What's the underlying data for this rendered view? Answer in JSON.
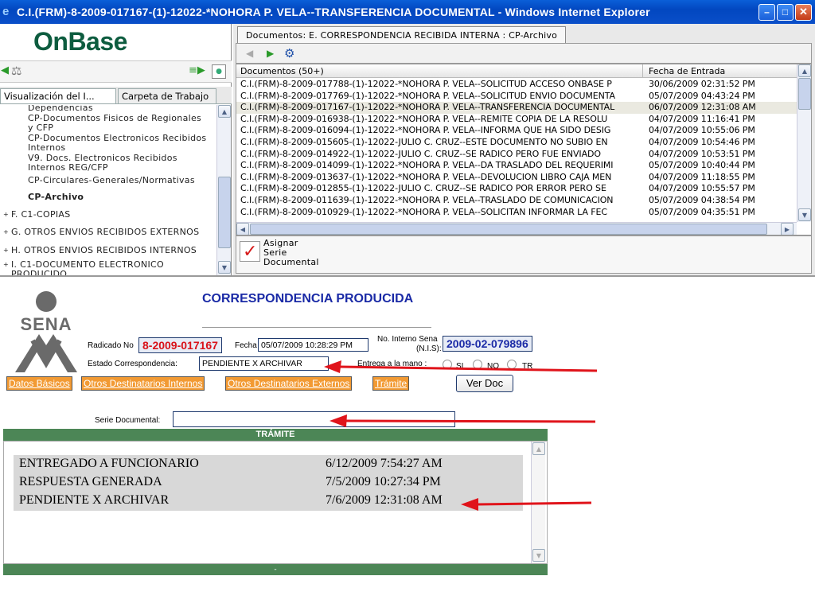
{
  "window": {
    "title": "C.I.(FRM)-8-2009-017167-(1)-12022-*NOHORA P. VELA--TRANSFERENCIA DOCUMENTAL - Windows Internet Explorer"
  },
  "left_panel": {
    "logo": "OnBase",
    "tabs": [
      "Visualización del I...",
      "Carpeta de Trabajo"
    ],
    "tree": [
      "Dependencias",
      "CP-Documentos Fisicos de Regionales",
      "y CFP",
      "CP-Documentos Electronicos Recibidos",
      "Internos",
      "V9. Docs. Electronicos Recibidos",
      "Internos REG/CFP",
      "CP-Circulares-Generales/Normativas",
      "CP-Archivo",
      "F. C1-COPIAS",
      "G. OTROS ENVIOS RECIBIDOS EXTERNOS",
      "H. OTROS ENVIOS RECIBIDOS INTERNOS",
      "I. C1-DOCUMENTO ELECTRONICO",
      "PRODUCIDO"
    ]
  },
  "right_panel": {
    "tab_label": "Documentos: E. CORRESPONDENCIA RECIBIDA INTERNA : CP-Archivo",
    "columns": [
      "Documentos (50+)",
      "Fecha de Entrada"
    ],
    "rows": [
      {
        "doc": "C.I.(FRM)-8-2009-017788-(1)-12022-*NOHORA P. VELA--SOLICITUD ACCESO ONBASE P",
        "date": "30/06/2009 02:31:52 PM"
      },
      {
        "doc": "C.I.(FRM)-8-2009-017769-(1)-12022-*NOHORA P. VELA--SOLICITUD ENVIO DOCUMENTA",
        "date": "05/07/2009 04:43:24 PM"
      },
      {
        "doc": "C.I.(FRM)-8-2009-017167-(1)-12022-*NOHORA P. VELA--TRANSFERENCIA DOCUMENTAL",
        "date": "06/07/2009 12:31:08 AM"
      },
      {
        "doc": "C.I.(FRM)-8-2009-016938-(1)-12022-*NOHORA P. VELA--REMITE COPIA DE LA RESOLU",
        "date": "04/07/2009 11:16:41 PM"
      },
      {
        "doc": "C.I.(FRM)-8-2009-016094-(1)-12022-*NOHORA P. VELA--INFORMA QUE HA SIDO DESIG",
        "date": "04/07/2009 10:55:06 PM"
      },
      {
        "doc": "C.I.(FRM)-8-2009-015605-(1)-12022-JULIO C. CRUZ--ESTE DOCUMENTO NO SUBIO EN",
        "date": "04/07/2009 10:54:46 PM"
      },
      {
        "doc": "C.I.(FRM)-8-2009-014922-(1)-12022-JULIO C. CRUZ--SE RADICO PERO FUE ENVIADO",
        "date": "04/07/2009 10:53:51 PM"
      },
      {
        "doc": "C.I.(FRM)-8-2009-014099-(1)-12022-*NOHORA P. VELA--DA TRASLADO DEL REQUERIMI",
        "date": "05/07/2009 10:40:44 PM"
      },
      {
        "doc": "C.I.(FRM)-8-2009-013637-(1)-12022-*NOHORA P. VELA--DEVOLUCION LIBRO CAJA MEN",
        "date": "04/07/2009 11:18:55 PM"
      },
      {
        "doc": "C.I.(FRM)-8-2009-012855-(1)-12022-JULIO C. CRUZ--SE RADICO POR ERROR PERO SE",
        "date": "04/07/2009 10:55:57 PM"
      },
      {
        "doc": "C.I.(FRM)-8-2009-011639-(1)-12022-*NOHORA P. VELA--TRASLADO DE COMUNICACION",
        "date": "05/07/2009 04:38:54 PM"
      },
      {
        "doc": "C.I.(FRM)-8-2009-010929-(1)-12022-*NOHORA P. VELA--SOLICITAN INFORMAR LA FEC",
        "date": "05/07/2009 04:35:51 PM"
      }
    ],
    "action_label": [
      "Asignar",
      "Serie",
      "Documental"
    ]
  },
  "form": {
    "logo_text": "SENA",
    "title": "CORRESPONDENCIA PRODUCIDA",
    "radicado_label": "Radicado No",
    "radicado_value": "8-2009-017167",
    "fecha_label": "Fecha",
    "fecha_value": "05/07/2009 10:28:29 PM",
    "interno_label": "No. Interno Sena",
    "interno_label2": "(N.I.S):",
    "interno_value": "2009-02-079896",
    "estado_label": "Estado Correspondencia:",
    "estado_value": "PENDIENTE X ARCHIVAR",
    "entrega_label": "Entrega a la mano :",
    "entrega_options": [
      "SI",
      "NO",
      "TR"
    ],
    "tabs": [
      "Datos Básicos",
      "Otros Destinatarios Internos",
      "Otros Destinatarios Externos",
      "Trámite"
    ],
    "verdoc_label": "Ver Doc",
    "serie_label": "Serie Documental:",
    "serie_value": "",
    "tramite_header": "TRÁMITE",
    "tramite_rows": [
      {
        "status": "ENTREGADO A FUNCIONARIO",
        "date": "6/12/2009 7:54:27 AM"
      },
      {
        "status": "RESPUESTA GENERADA",
        "date": "7/5/2009 10:27:34 PM"
      },
      {
        "status": "PENDIENTE X ARCHIVAR",
        "date": "7/6/2009 12:31:08 AM"
      }
    ],
    "tramite_footer": "-"
  },
  "colors": {
    "title_blue": "#1a2aa6",
    "radicado_red": "#d9121a",
    "tab_orange": "#f29a33",
    "tramite_green": "#4c8656",
    "arrow_red": "#e0141b"
  }
}
